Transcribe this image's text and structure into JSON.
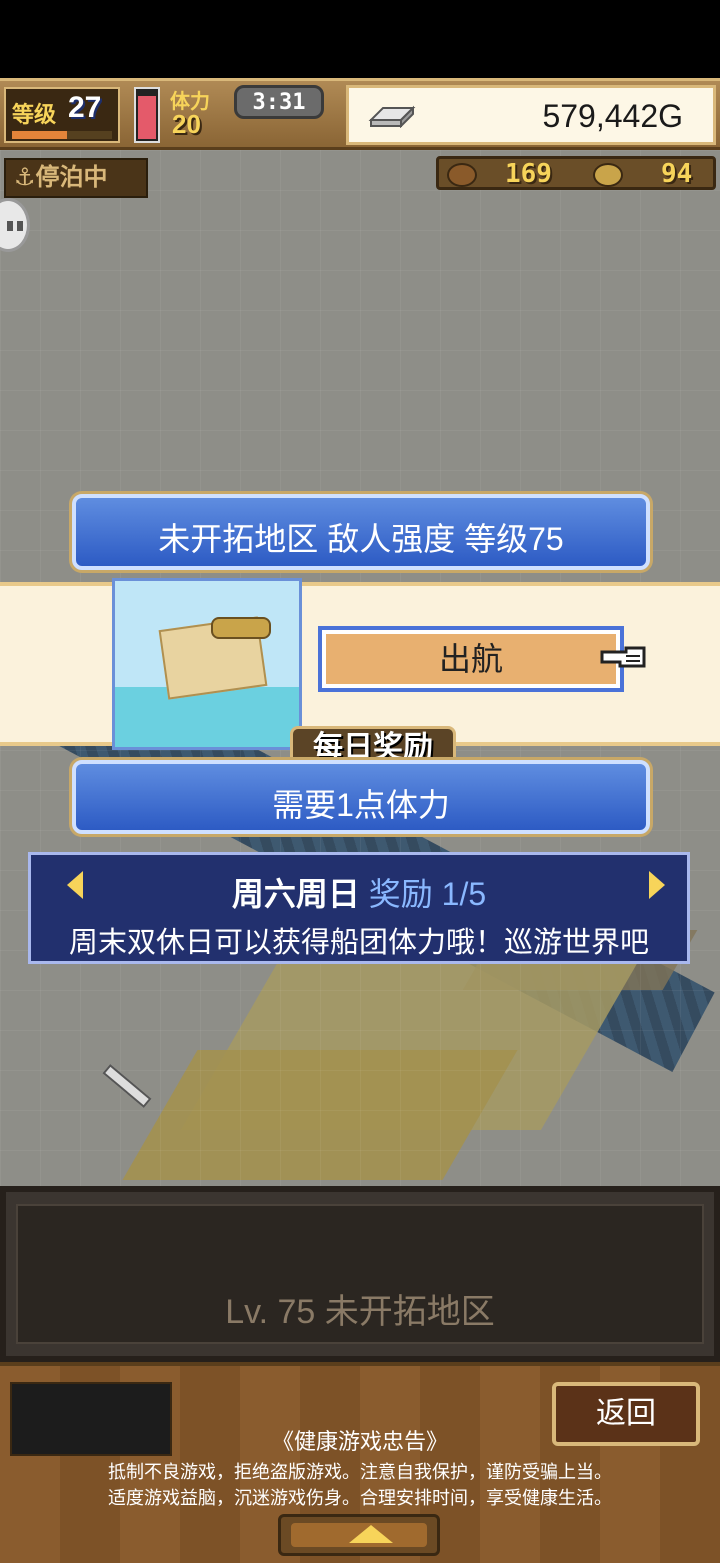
{
  "hud": {
    "level_label": "等级",
    "level_value": "27",
    "level_progress": 0.55,
    "stamina_label": "体力",
    "stamina_value": "20",
    "stamina_fill": 0.9,
    "timer": "3:31",
    "gold": "579,442G"
  },
  "map": {
    "docked_label": "停泊中",
    "resource_1": "169",
    "resource_2": "94"
  },
  "dialog": {
    "title": "未开拓地区  敌人强度 等级75",
    "sail_button": "出航",
    "daily_badge": "每日奖励",
    "requirement": "需要1点体力",
    "reward_days": "周六周日",
    "reward_word": "奖励 1/5",
    "reward_desc": "周末双休日可以获得船团体力哦！巡游世界吧"
  },
  "info": {
    "text": "Lv. 75 未开拓地区"
  },
  "footer": {
    "back_button": "返回",
    "advice_title": "《健康游戏忠告》",
    "advice_line_1": "抵制不良游戏，拒绝盗版游戏。注意自我保护，谨防受骗上当。",
    "advice_line_2": "适度游戏益脑，沉迷游戏伤身。合理安排时间，享受健康生活。"
  },
  "colors": {
    "hud_gold": "#f7d45a",
    "plate_blue": "#2d5bc4",
    "sail_button": "#e8b070",
    "reward_accent": "#8ab8ff"
  }
}
